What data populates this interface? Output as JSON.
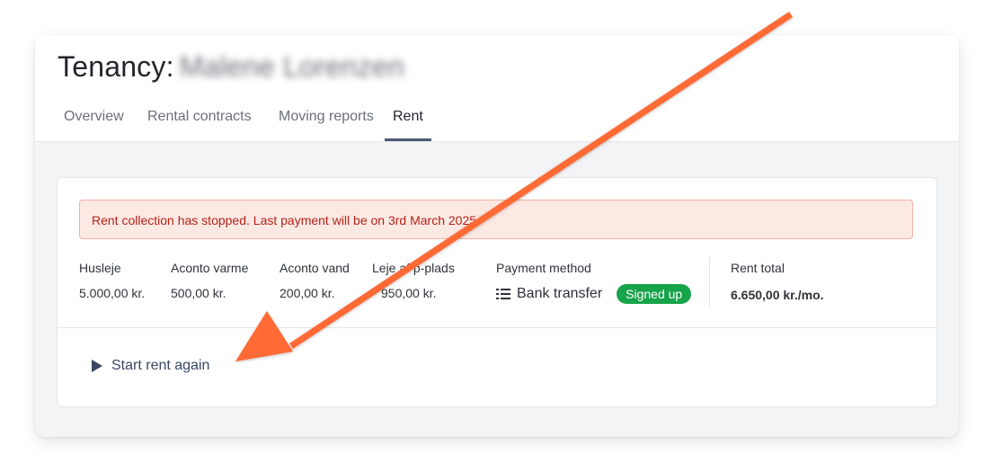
{
  "header": {
    "title_prefix": "Tenancy:",
    "tenant_name": "Malene Lorenzen",
    "tabs": [
      {
        "label": "Overview"
      },
      {
        "label": "Rental contracts"
      },
      {
        "label": "Moving reports"
      },
      {
        "label": "Rent"
      }
    ],
    "active_tab": "Rent"
  },
  "alert": {
    "text": "Rent collection has stopped. Last payment will be on 3rd March 2025"
  },
  "rent_items": [
    {
      "label": "Husleje",
      "value": "5.000,00 kr."
    },
    {
      "label": "Aconto varme",
      "value": "500,00 kr."
    },
    {
      "label": "Aconto vand",
      "value": "200,00 kr."
    },
    {
      "label": "Leje af p-plads",
      "value": "950,00 kr."
    }
  ],
  "payment_method": {
    "label": "Payment method",
    "value": "Bank transfer",
    "icon": "list-icon",
    "status": "Signed up"
  },
  "rent_total": {
    "label": "Rent total",
    "value": "6.650,00 kr./mo."
  },
  "actions": {
    "start_label": "Start rent again"
  },
  "colors": {
    "alert_bg": "#fde9e4",
    "alert_text": "#b42318",
    "badge": "#17a34a",
    "accent": "#3a4763",
    "annotation_arrow": "#ff6b35"
  }
}
